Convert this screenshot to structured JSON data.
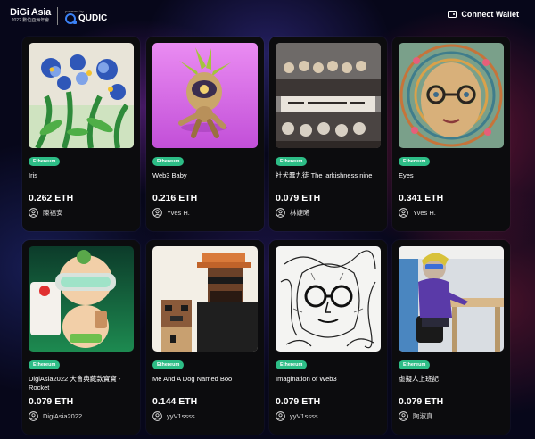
{
  "header": {
    "logo_main": "DiGi Asia",
    "logo_sub": "2022 數位亞洲年會",
    "powered_by": "powered by",
    "partner_name": "QUDIC",
    "connect_wallet": "Connect Wallet"
  },
  "cards": [
    {
      "chain": "Ethereum",
      "title": "Iris",
      "price": "0.262 ETH",
      "owner": "陳福安",
      "art": "flower-painting"
    },
    {
      "chain": "Ethereum",
      "title": "Web3 Baby",
      "price": "0.216 ETH",
      "owner": "Yves H.",
      "art": "3d-character"
    },
    {
      "chain": "Ethereum",
      "title": "社犬蠢九徒 The larkishness nine",
      "price": "0.079 ETH",
      "owner": "林婕晞",
      "art": "last-supper-dogs"
    },
    {
      "chain": "Ethereum",
      "title": "Eyes",
      "price": "0.341 ETH",
      "owner": "Yves H.",
      "art": "psychedelic-face"
    },
    {
      "chain": "Ethereum",
      "title": "DigiAsia2022 大會典藏款寶寶 - Rocket",
      "price": "0.079 ETH",
      "owner": "DigiAsia2022",
      "art": "vr-baby"
    },
    {
      "chain": "Ethereum",
      "title": "Me And A Dog Named Boo",
      "price": "0.144 ETH",
      "owner": "yyV1ssss",
      "art": "pixel-man-dog"
    },
    {
      "chain": "Ethereum",
      "title": "Imagination of Web3",
      "price": "0.079 ETH",
      "owner": "yyV1ssss",
      "art": "sketch-face"
    },
    {
      "chain": "Ethereum",
      "title": "虛擬人上班記",
      "price": "0.079 ETH",
      "owner": "陶淑真",
      "art": "virtual-office"
    }
  ],
  "colors": {
    "badge": "#2dbd86",
    "card_bg": "#0c0c0e",
    "accent_blue": "#3b82f6"
  }
}
